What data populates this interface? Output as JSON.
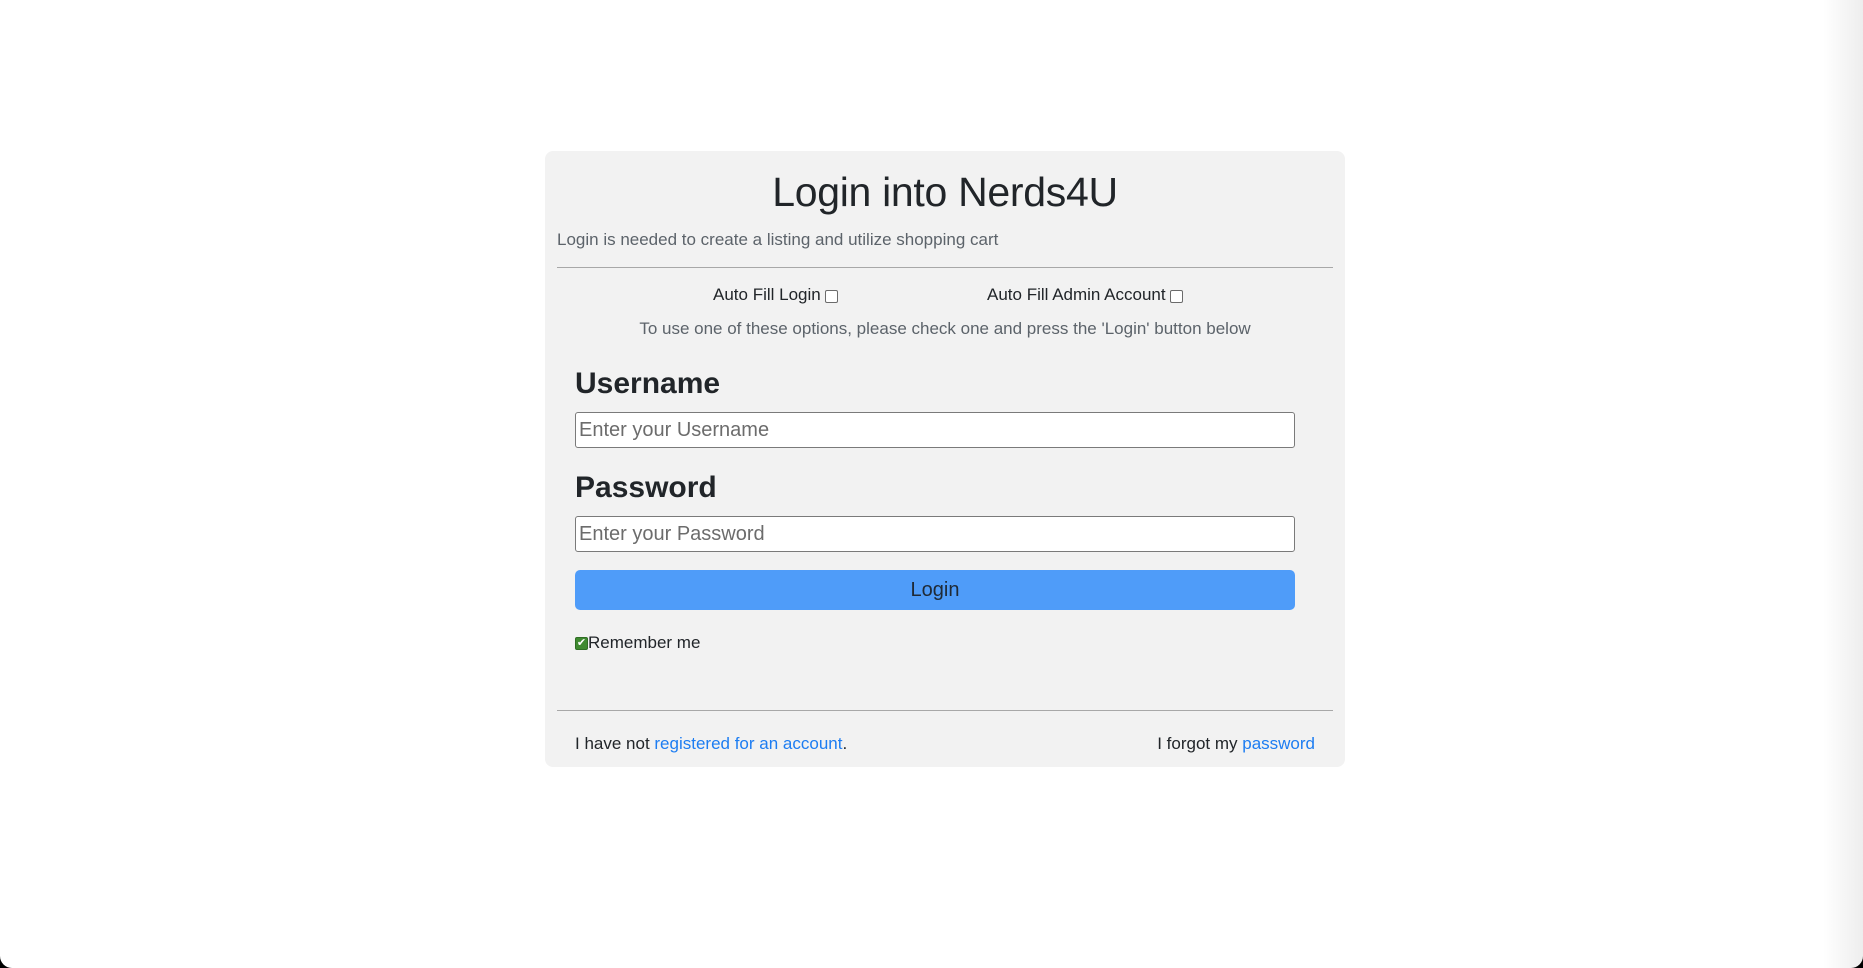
{
  "login_card": {
    "title": "Login into Nerds4U",
    "subtitle": "Login is needed to create a listing and utilize shopping cart",
    "autofill_login_label": "Auto Fill Login",
    "autofill_admin_label": "Auto Fill Admin Account",
    "hint": "To use one of these options, please check one and press the 'Login' button below",
    "username_label": "Username",
    "username_placeholder": "Enter your Username",
    "password_label": "Password",
    "password_placeholder": "Enter your Password",
    "login_button": "Login",
    "remember_label": "Remember me",
    "remember_checked": true,
    "autofill_login_checked": false,
    "autofill_admin_checked": false
  },
  "footer": {
    "register_prefix": "I have not ",
    "register_link": "registered for an account",
    "register_suffix": ".",
    "forgot_prefix": "I forgot my ",
    "forgot_link": "password"
  },
  "colors": {
    "card_background": "#f2f2f2",
    "button_blue": "#4f9cf9",
    "link_blue": "#1d7df2",
    "checkbox_green": "#3f8a30"
  },
  "icons": {
    "remember_check": "✔"
  }
}
